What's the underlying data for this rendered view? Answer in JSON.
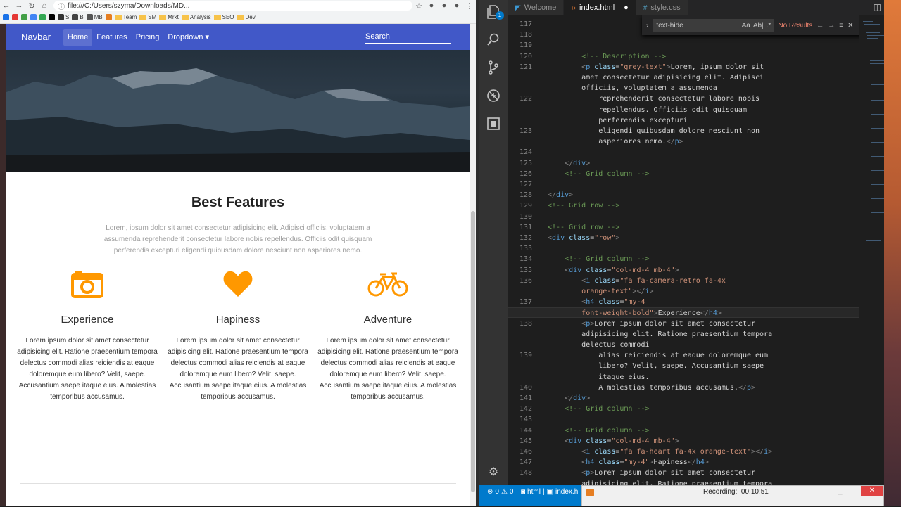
{
  "browser": {
    "url": "file:///C:/Users/szyma/Downloads/MD...",
    "bookmarks": [
      "",
      "",
      "",
      "",
      "",
      "",
      "S",
      "B",
      "MB",
      "",
      "Team",
      "SM",
      "Mrkt",
      "Analysis",
      "SEO",
      "Dev"
    ],
    "site": {
      "brand": "Navbar",
      "nav_links": [
        "Home",
        "Features",
        "Pricing",
        "Dropdown ▾"
      ],
      "search_placeholder": "Search"
    },
    "features": {
      "title": "Best Features",
      "description": "Lorem, ipsum dolor sit amet consectetur adipisicing elit. Adipisci officiis, voluptatem a assumenda reprehenderit consectetur labore nobis repellendus. Officiis odit quisquam perferendis excepturi eligendi quibusdam dolore nesciunt non asperiores nemo.",
      "items": [
        {
          "icon": "camera-retro-icon",
          "heading": "Experience",
          "text": "Lorem ipsum dolor sit amet consectetur adipisicing elit. Ratione praesentium tempora delectus commodi alias reiciendis at eaque doloremque eum libero? Velit, saepe. Accusantium saepe itaque eius. A molestias temporibus accusamus."
        },
        {
          "icon": "heart-icon",
          "heading": "Hapiness",
          "text": "Lorem ipsum dolor sit amet consectetur adipisicing elit. Ratione praesentium tempora delectus commodi alias reiciendis at eaque doloremque eum libero? Velit, saepe. Accusantium saepe itaque eius. A molestias temporibus accusamus."
        },
        {
          "icon": "bicycle-icon",
          "heading": "Adventure",
          "text": "Lorem ipsum dolor sit amet consectetur adipisicing elit. Ratione praesentium tempora delectus commodi alias reiciendis at eaque doloremque eum libero? Velit, saepe. Accusantium saepe itaque eius. A molestias temporibus accusamus."
        }
      ],
      "accent_color": "#ff9800"
    }
  },
  "editor": {
    "tabs": [
      {
        "label": "Welcome",
        "icon": "vscode-icon"
      },
      {
        "label": "index.html",
        "icon": "html-icon",
        "modified": true
      },
      {
        "label": "style.css",
        "icon": "css-icon"
      }
    ],
    "find": {
      "query": "text-hide",
      "toggles": [
        "Aa",
        "Ab|",
        ".*"
      ],
      "result": "No Results"
    },
    "lines": [
      {
        "n": "117",
        "html": ""
      },
      {
        "n": "118",
        "html": ""
      },
      {
        "n": "119",
        "html": ""
      },
      {
        "n": "120",
        "html": "        <span class='cm'>&lt;!-- Description --&gt;</span>"
      },
      {
        "n": "121",
        "html": "        <span class='br'>&lt;</span><span class='tg'>p</span> <span class='at'>class</span>=<span class='st'>\"grey-text\"</span><span class='br'>&gt;</span>Lorem, ipsum dolor sit"
      },
      {
        "n": "",
        "html": "        amet consectetur adipisicing elit. Adipisci"
      },
      {
        "n": "",
        "html": "        officiis, voluptatem a assumenda"
      },
      {
        "n": "122",
        "html": "            reprehenderit consectetur labore nobis"
      },
      {
        "n": "",
        "html": "            repellendus. Officiis odit quisquam"
      },
      {
        "n": "",
        "html": "            perferendis excepturi"
      },
      {
        "n": "123",
        "html": "            eligendi quibusdam dolore nesciunt non"
      },
      {
        "n": "",
        "html": "            asperiores nemo.<span class='br'>&lt;/</span><span class='tg'>p</span><span class='br'>&gt;</span>"
      },
      {
        "n": "124",
        "html": ""
      },
      {
        "n": "125",
        "html": "    <span class='br'>&lt;/</span><span class='tg'>div</span><span class='br'>&gt;</span>"
      },
      {
        "n": "126",
        "html": "    <span class='cm'>&lt;!-- Grid column --&gt;</span>"
      },
      {
        "n": "127",
        "html": ""
      },
      {
        "n": "128",
        "html": "<span class='br'>&lt;/</span><span class='tg'>div</span><span class='br'>&gt;</span>"
      },
      {
        "n": "129",
        "html": "<span class='cm'>&lt;!-- Grid row --&gt;</span>"
      },
      {
        "n": "130",
        "html": ""
      },
      {
        "n": "131",
        "html": "<span class='cm'>&lt;!-- Grid row --&gt;</span>"
      },
      {
        "n": "132",
        "html": "<span class='br'>&lt;</span><span class='tg'>div</span> <span class='at'>class</span>=<span class='st'>\"row\"</span><span class='br'>&gt;</span>"
      },
      {
        "n": "133",
        "html": ""
      },
      {
        "n": "134",
        "html": "    <span class='cm'>&lt;!-- Grid column --&gt;</span>"
      },
      {
        "n": "135",
        "html": "    <span class='br'>&lt;</span><span class='tg'>div</span> <span class='at'>class</span>=<span class='st'>\"col-md-4 mb-4\"</span><span class='br'>&gt;</span>"
      },
      {
        "n": "136",
        "html": "        <span class='br'>&lt;</span><span class='tg'>i</span> <span class='at'>class</span>=<span class='st'>\"fa fa-camera-retro fa-4x</span>"
      },
      {
        "n": "",
        "html": "        <span class='st'>orange-text\"</span><span class='br'>&gt;&lt;/</span><span class='tg'>i</span><span class='br'>&gt;</span>"
      },
      {
        "n": "137",
        "html": "        <span class='br'>&lt;</span><span class='tg'>h4</span> <span class='at'>class</span>=<span class='st'>\"my-4</span>"
      },
      {
        "n": "",
        "html": "        <span class='st'>font-weight-bold\"</span><span class='br'>&gt;</span>Experience<span class='br'>&lt;/</span><span class='tg'>h4</span><span class='br'>&gt;</span>",
        "current": true
      },
      {
        "n": "138",
        "html": "        <span class='br'>&lt;</span><span class='tg'>p</span><span class='br'>&gt;</span>Lorem ipsum dolor sit amet consectetur"
      },
      {
        "n": "",
        "html": "        adipisicing elit. Ratione praesentium tempora"
      },
      {
        "n": "",
        "html": "        delectus commodi"
      },
      {
        "n": "139",
        "html": "            alias reiciendis at eaque doloremque eum"
      },
      {
        "n": "",
        "html": "            libero? Velit, saepe. Accusantium saepe"
      },
      {
        "n": "",
        "html": "            itaque eius."
      },
      {
        "n": "140",
        "html": "            A molestias temporibus accusamus.<span class='br'>&lt;/</span><span class='tg'>p</span><span class='br'>&gt;</span>"
      },
      {
        "n": "141",
        "html": "    <span class='br'>&lt;/</span><span class='tg'>div</span><span class='br'>&gt;</span>"
      },
      {
        "n": "142",
        "html": "    <span class='cm'>&lt;!-- Grid column --&gt;</span>"
      },
      {
        "n": "143",
        "html": ""
      },
      {
        "n": "144",
        "html": "    <span class='cm'>&lt;!-- Grid column --&gt;</span>"
      },
      {
        "n": "145",
        "html": "    <span class='br'>&lt;</span><span class='tg'>div</span> <span class='at'>class</span>=<span class='st'>\"col-md-4 mb-4\"</span><span class='br'>&gt;</span>"
      },
      {
        "n": "146",
        "html": "        <span class='br'>&lt;</span><span class='tg'>i</span> <span class='at'>class</span>=<span class='st'>\"fa fa-heart fa-4x orange-text\"</span><span class='br'>&gt;&lt;/</span><span class='tg'>i</span><span class='br'>&gt;</span>"
      },
      {
        "n": "147",
        "html": "        <span class='br'>&lt;</span><span class='tg'>h4</span> <span class='at'>class</span>=<span class='st'>\"my-4\"</span><span class='br'>&gt;</span>Hapiness<span class='br'>&lt;/</span><span class='tg'>h4</span><span class='br'>&gt;</span>"
      },
      {
        "n": "148",
        "html": "        <span class='br'>&lt;</span><span class='tg'>p</span><span class='br'>&gt;</span>Lorem ipsum dolor sit amet consectetur"
      },
      {
        "n": "",
        "html": "        adipisicing elit. Ratione praesentium tempora"
      }
    ],
    "statusbar": {
      "errors": "0",
      "warnings": "0",
      "items": [
        "html",
        "index.h"
      ]
    }
  },
  "recorder": {
    "label": "Recording:",
    "time": "00:10:51",
    "minimize": "_",
    "close": "✕"
  }
}
